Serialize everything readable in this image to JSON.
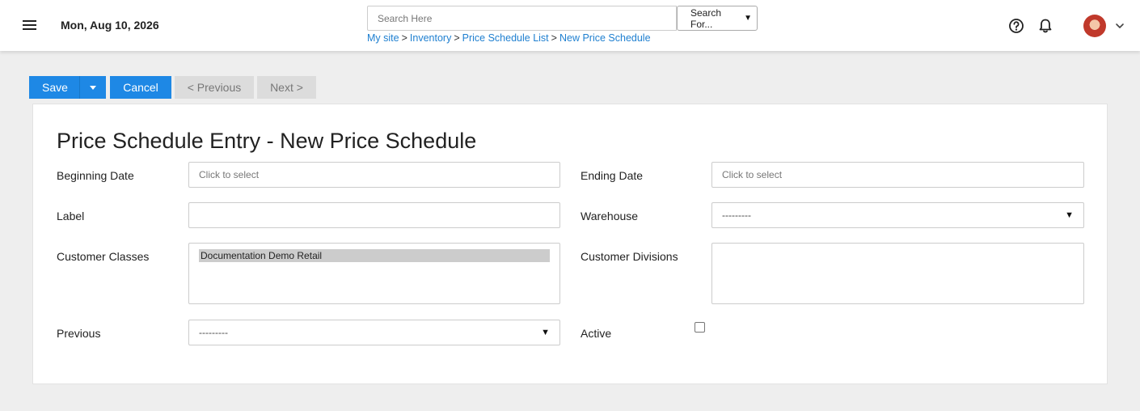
{
  "header": {
    "date": "Mon, Aug 10, 2026",
    "search_placeholder": "Search Here",
    "search_for": "Search For...",
    "breadcrumb": [
      "My site",
      "Inventory",
      "Price Schedule List",
      "New Price Schedule"
    ],
    "breadcrumb_sep": ">"
  },
  "toolbar": {
    "save": "Save",
    "cancel": "Cancel",
    "previous": "< Previous",
    "next": "Next >"
  },
  "form": {
    "title": "Price Schedule Entry - New Price Schedule",
    "beginning_date_label": "Beginning Date",
    "beginning_date_placeholder": "Click to select",
    "ending_date_label": "Ending Date",
    "ending_date_placeholder": "Click to select",
    "label_label": "Label",
    "label_value": "",
    "warehouse_label": "Warehouse",
    "warehouse_value": "---------",
    "customer_classes_label": "Customer Classes",
    "customer_classes_options": [
      "Documentation Demo Retail"
    ],
    "customer_divisions_label": "Customer Divisions",
    "previous_label": "Previous",
    "previous_value": "---------",
    "active_label": "Active",
    "active_checked": false
  },
  "colors": {
    "primary": "#1e88e5",
    "link": "#1e7fd0",
    "background": "#eeeeee"
  },
  "icons": [
    "menu-icon",
    "help-icon",
    "bell-icon",
    "chevron-down-icon"
  ]
}
